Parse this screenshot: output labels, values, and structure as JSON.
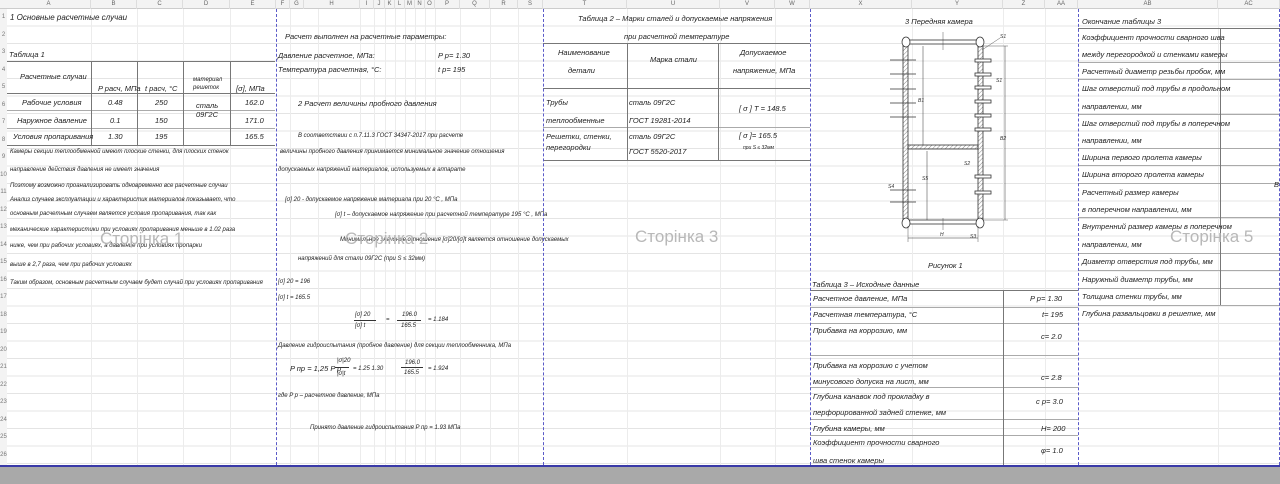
{
  "columns": [
    "A",
    "B",
    "C",
    "D",
    "E",
    "F",
    "G",
    "H",
    "I",
    "J",
    "K",
    "L",
    "M",
    "N",
    "O",
    "P",
    "Q",
    "R",
    "S",
    "T",
    "U",
    "V",
    "W",
    "X",
    "Y",
    "Z",
    "AA",
    "AB",
    "AC"
  ],
  "rows": [
    "1",
    "2",
    "3",
    "4",
    "5",
    "6",
    "7",
    "8",
    "9",
    "10",
    "11",
    "12",
    "13",
    "14",
    "15",
    "16",
    "17",
    "18",
    "19",
    "20",
    "21",
    "22",
    "23",
    "24",
    "25",
    "26"
  ],
  "watermarks": [
    "Сторінка 1",
    "Сторінка 2",
    "Сторінка 3",
    "Сторінка 5"
  ],
  "page1": {
    "title": "1  Основные расчетные случаи",
    "table_label": "Таблица 1",
    "headers": [
      "Расчетные случаи",
      "P расч, МПа",
      "t расч, °C",
      "материал",
      "решеток",
      "[σ], МПа"
    ],
    "rows": [
      {
        "case": "Рабочие условия",
        "p": "0.48",
        "t": "250",
        "sigma": "162.0"
      },
      {
        "case": "Наружное давление",
        "p": "0.1",
        "t": "150",
        "sigma": "171.0"
      },
      {
        "case": "Условия пропаривания",
        "p": "1.30",
        "t": "195",
        "sigma": "165.5"
      }
    ],
    "material": [
      "сталь",
      "09Г2С"
    ],
    "paragraph": [
      "Камеры секции теплообменной имеют плоские стенки, для плоских стенок",
      "направление действия давления не имеет значения",
      "Поэтому возможно проанализировать одновременно все расчетные случаи",
      "Анализ случаев эксплуатации и характеристик материалов показывает, что",
      "основным расчетным случаем является условия пропаривания, так как",
      "механические характеристики при условиях пропаривания меньше в 1.02 раза",
      "ниже, чем при рабочих условиях,  а давление при условиях пропарки",
      " выше в 2,7 раза, чем при рабочих условиях",
      "Таким образом, основным расчетным случаем будет случай при условиях пропаривания"
    ]
  },
  "page2": {
    "heading": "Расчет выполнен на расчетные параметры:",
    "pressure_label": "Давление расчетное, МПа:",
    "pressure_value": "P р=  1.30",
    "temp_label": "Температура расчетная, °C:",
    "temp_value": "t р=  195",
    "section": "2  Расчет  величины пробного давления",
    "lines": [
      "В соответствии  с п.7.11.3 ГОСТ 34347-2017 при расчете",
      "величины пробного давления принимается минимальное значение отношения",
      "допускаемых напряжений материалов, используемых в аппарате",
      "[σ] 20 - допускаемое напряжение материала при 20 °C , МПа",
      "[σ] t – допускаемое напряжение  при расчетной температуре  195 °C , МПа",
      "Минимальное значение отношения [σ]20/[σ]t является отношение допускаемых",
      "напряжений для стали 09Г2С (при S ≤ 32мм)",
      "[σ] 20  =  196",
      "[σ] t  =  165.5"
    ],
    "ratio": {
      "num": "[σ] 20",
      "den": "[σ] t",
      "eq": "=",
      "vnum": "196.0",
      "vden": "165.5",
      "result": "=   1.184"
    },
    "hydro_label": "Давление гидроиспытания (пробное давление) для секции теплообменника, МПа",
    "formula": {
      "lhs": "P пр = 1,25 P р",
      "num": "|σ|20",
      "den": "|σ|t",
      "rest": "= 1.25     1.30",
      "vnum": "196.0",
      "vden": "165.5",
      "result": "=     1.924"
    },
    "where": "где  P р  –  расчетное давление, МПа",
    "accepted": "Принято давление гидроиспытания P пр  =  1.93     МПа"
  },
  "page3": {
    "title": "Таблица 2 – Марки сталей и допускаемые напряжения",
    "subtitle": "при расчетной температуре",
    "headers": [
      "Наименование",
      "детали",
      "Марка стали",
      "Допускаемое",
      "напряжение, МПа"
    ],
    "rows": [
      {
        "part": [
          "Трубы",
          "теплообменные"
        ],
        "steel": [
          "сталь  09Г2С",
          "ГОСТ  19281-2014"
        ],
        "stress": "[ σ ] T =  148.5",
        "note": ""
      },
      {
        "part": [
          "Решетки,  стенки,",
          "перегородки"
        ],
        "steel": [
          "сталь  09Г2С",
          "ГОСТ  5520-2017"
        ],
        "stress": "[ σ ]=  165.5",
        "note": "при S  ≤  32мм"
      }
    ]
  },
  "page4": {
    "title": "3     Передняя камера",
    "figure_caption": "Рисунок 1",
    "dim_labels": [
      "S1",
      "S1",
      "B1",
      "B2",
      "S2",
      "S3",
      "S4",
      "S5",
      "H"
    ],
    "table_title": "Таблица 3 – Исходные данные",
    "rows": [
      {
        "label": [
          "Расчетное давление, МПа"
        ],
        "value": "P р=  1.30"
      },
      {
        "label": [
          "Расчетная температура, °C"
        ],
        "value": "t=  195"
      },
      {
        "label": [
          "Прибавка на коррозию, мм"
        ],
        "value": "c=  2.0"
      },
      {
        "label": [
          "Прибавка на коррозию с учетом",
          "минусового допуска на лист, мм"
        ],
        "value": "c=  2.8"
      },
      {
        "label": [
          "Глубина канавок под прокладку в",
          "перфорированной задней стенке, мм"
        ],
        "value": "c р=  3.0"
      },
      {
        "label": [
          "Глубина камеры, мм"
        ],
        "value": "H=  200"
      },
      {
        "label": [
          "Коэффициент прочности сварного",
          "шва стенок камеры"
        ],
        "value": "φ=  1.0"
      }
    ]
  },
  "page5": {
    "title": "Окончание таблицы 3",
    "lines": [
      "Коэффициент прочности сварного шва",
      "между перегородкой и стенками камеры",
      "Расчетный диаметр резьбы пробок, мм",
      "Шаг отверстий под трубы в продольном",
      "направлении, мм",
      "Шаг отверстий под трубы в поперечном",
      "направлении, мм",
      "Ширина первого пролета камеры",
      "Ширина второго пролета камеры",
      "Расчетный размер камеры",
      "в поперечном направлении, мм",
      "Внутренний размер камеры в поперечном",
      "направлении, мм",
      "Диаметр отверстия под трубы, мм",
      "Наружный диаметр трубы, мм",
      "Толщина стенки трубы, мм",
      "Глубина развальцовки в решетке, мм"
    ],
    "cut_value": "В"
  }
}
